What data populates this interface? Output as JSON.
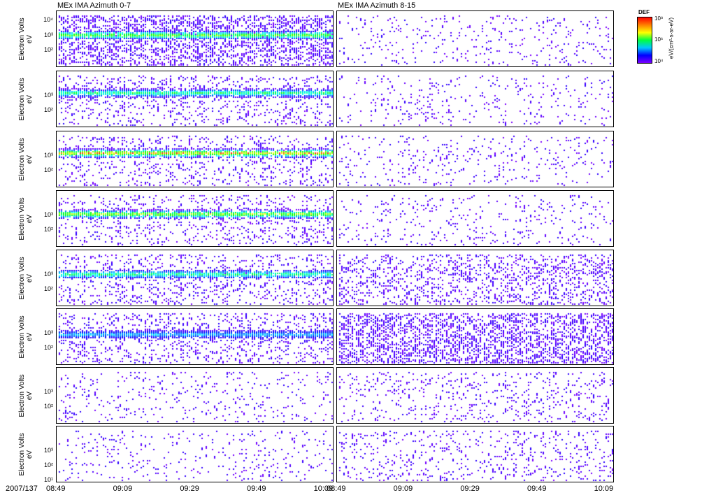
{
  "chart_data": {
    "type": "heatmap",
    "columns": [
      {
        "title": "MEx IMA Azimuth 0-7"
      },
      {
        "title": "MEx IMA Azimuth 8-15"
      }
    ],
    "ylabel": "Electron Volts",
    "yunit": "eV",
    "ylim_log10": [
      0.86,
      4.67
    ],
    "date": "2007/137",
    "x_ticks": [
      "08:49",
      "09:09",
      "09:29",
      "09:49",
      "10:09"
    ],
    "x_tick_minutes": [
      0,
      20,
      40,
      60,
      80
    ],
    "x_range_minutes": [
      0,
      83
    ],
    "colorbar": {
      "label": "DEF",
      "unit": "eV/(cm²-s-sr-eV)",
      "ticks": [
        "10⁸",
        "10⁶",
        "10⁴"
      ]
    },
    "rows": [
      {
        "yticks": [
          "10⁴",
          "10³",
          "10²"
        ],
        "left": {
          "band_log_ev": 3.1,
          "band_level": 0.65,
          "bg": 0.85
        },
        "right": {
          "band_level": 0,
          "bg": 0.15
        }
      },
      {
        "yticks": [
          "10³",
          "10²"
        ],
        "left": {
          "band_log_ev": 3.25,
          "band_level": 0.5,
          "bg": 0.35
        },
        "right": {
          "band_level": 0,
          "bg": 0.15
        }
      },
      {
        "yticks": [
          "10³",
          "10²"
        ],
        "left": {
          "band_log_ev": 3.25,
          "band_level": 0.85,
          "bg": 0.3
        },
        "right": {
          "band_level": 0,
          "bg": 0.15
        }
      },
      {
        "yticks": [
          "10³",
          "10²"
        ],
        "left": {
          "band_log_ev": 3.15,
          "band_level": 0.7,
          "bg": 0.3
        },
        "right": {
          "band_level": 0,
          "bg": 0.15
        }
      },
      {
        "yticks": [
          "10³",
          "10²"
        ],
        "left": {
          "band_log_ev": 3.1,
          "band_level": 0.5,
          "bg": 0.35
        },
        "right": {
          "band_level": 0,
          "bg": 0.5
        }
      },
      {
        "yticks": [
          "10³",
          "10²"
        ],
        "left": {
          "band_log_ev": 3.0,
          "band_level": 0.3,
          "bg": 0.4
        },
        "right": {
          "band_level": 0,
          "bg": 0.85
        }
      },
      {
        "yticks": [
          "10³",
          "10²"
        ],
        "left": {
          "band_level": 0,
          "bg": 0.15
        },
        "right": {
          "band_level": 0,
          "bg": 0.25
        }
      },
      {
        "yticks": [
          "10³",
          "10²",
          "10¹"
        ],
        "left": {
          "band_level": 0,
          "bg": 0.15
        },
        "right": {
          "band_level": 0,
          "bg": 0.25
        }
      }
    ]
  }
}
